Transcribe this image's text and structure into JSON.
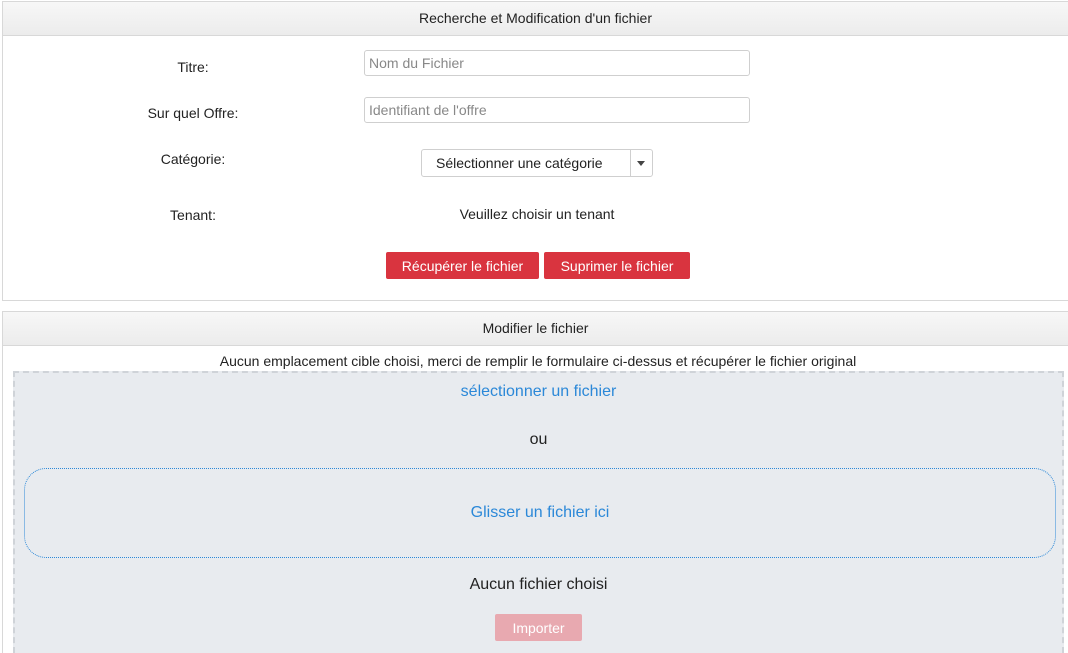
{
  "search_panel": {
    "title": "Recherche et Modification d'un fichier",
    "titre_label": "Titre:",
    "titre_placeholder": "Nom du Fichier",
    "titre_value": "",
    "offre_label": "Sur quel Offre:",
    "offre_placeholder": "Identifiant de l'offre",
    "offre_value": "",
    "categorie_label": "Catégorie:",
    "categorie_selected": "Sélectionner une catégorie",
    "tenant_label": "Tenant:",
    "tenant_value": "Veuillez choisir un tenant",
    "recuperer_button": "Récupérer le fichier",
    "supprimer_button": "Suprimer le fichier"
  },
  "modify_panel": {
    "title": "Modifier le fichier",
    "info_message": "Aucun emplacement cible choisi, merci de remplir le formulaire ci-dessus et récupérer le fichier original",
    "select_file_link": "sélectionner un fichier",
    "or_text": "ou",
    "drop_text": "Glisser un fichier ici",
    "no_file_text": "Aucun fichier choisi",
    "import_button": "Importer"
  },
  "colors": {
    "primary_red": "#d9343f",
    "disabled_red": "#e8a9b0",
    "link_blue": "#2b88d8",
    "dropzone_bg": "#e8ebef"
  },
  "icons": {
    "select_caret": "chevron-down-icon"
  }
}
